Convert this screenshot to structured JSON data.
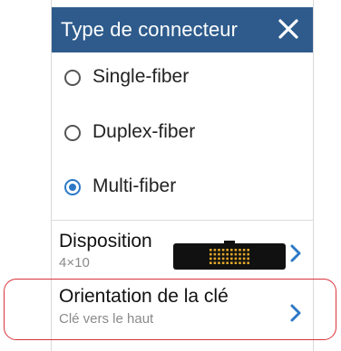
{
  "dialog": {
    "title": "Type de connecteur",
    "close_icon": "close-icon"
  },
  "options": [
    {
      "label": "Single-fiber",
      "checked": false
    },
    {
      "label": "Duplex-fiber",
      "checked": false
    },
    {
      "label": "Multi-fiber",
      "checked": true
    }
  ],
  "disposition": {
    "title": "Disposition",
    "value": "4×10",
    "icon": "mpo-connector-icon"
  },
  "orientation": {
    "title": "Orientation de la clé",
    "value": "Clé vers le haut"
  },
  "colors": {
    "header": "#2e5b8c",
    "accent": "#2d78c6",
    "highlight": "#d9343b"
  }
}
